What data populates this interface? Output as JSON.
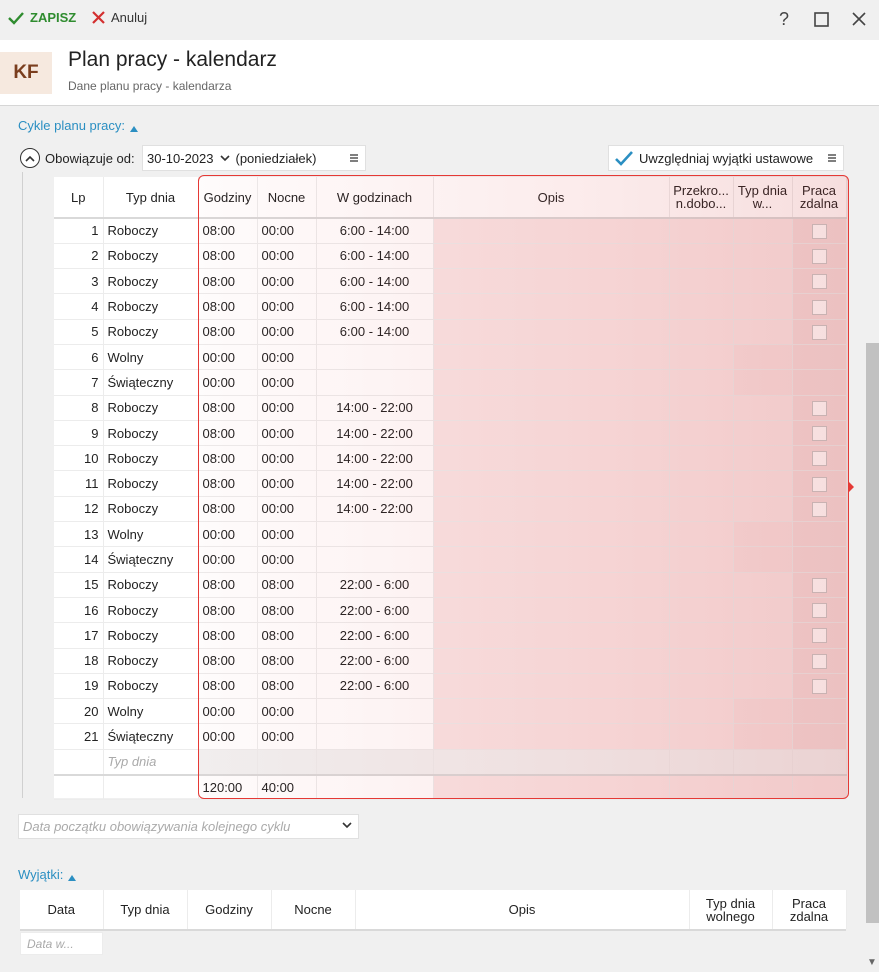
{
  "toolbar": {
    "save_label": "ZAPISZ",
    "cancel_label": "Anuluj"
  },
  "window": {
    "help_glyph": "?",
    "max_glyph": "☐",
    "close_glyph": "✕"
  },
  "header": {
    "avatar": "KF",
    "title": "Plan pracy - kalendarz",
    "subtitle": "Dane planu pracy - kalendarza"
  },
  "cycles": {
    "section_label": "Cykle planu pracy:",
    "valid_from_label": "Obowiązuje od:",
    "valid_from_value": "30-10-2023",
    "valid_from_day": "(poniedziałek)",
    "include_exceptions_label": "Uwzględniaj wyjątki ustawowe",
    "include_exceptions_checked": true
  },
  "grid": {
    "columns": [
      "Lp",
      "Typ dnia",
      "Godziny",
      "Nocne",
      "W godzinach",
      "Opis",
      "Przekro... n.dobo...",
      "Typ dnia w...",
      "Praca zdalna"
    ],
    "rows": [
      {
        "lp": "1",
        "typ": "Roboczy",
        "godziny": "08:00",
        "nocne": "00:00",
        "w_godz": "6:00 - 14:00",
        "cb": true
      },
      {
        "lp": "2",
        "typ": "Roboczy",
        "godziny": "08:00",
        "nocne": "00:00",
        "w_godz": "6:00 - 14:00",
        "cb": true
      },
      {
        "lp": "3",
        "typ": "Roboczy",
        "godziny": "08:00",
        "nocne": "00:00",
        "w_godz": "6:00 - 14:00",
        "cb": true
      },
      {
        "lp": "4",
        "typ": "Roboczy",
        "godziny": "08:00",
        "nocne": "00:00",
        "w_godz": "6:00 - 14:00",
        "cb": true
      },
      {
        "lp": "5",
        "typ": "Roboczy",
        "godziny": "08:00",
        "nocne": "00:00",
        "w_godz": "6:00 - 14:00",
        "cb": true
      },
      {
        "lp": "6",
        "typ": "Wolny",
        "godziny": "00:00",
        "nocne": "00:00",
        "w_godz": "",
        "cb": false
      },
      {
        "lp": "7",
        "typ": "Świąteczny",
        "godziny": "00:00",
        "nocne": "00:00",
        "w_godz": "",
        "cb": false
      },
      {
        "lp": "8",
        "typ": "Roboczy",
        "godziny": "08:00",
        "nocne": "00:00",
        "w_godz": "14:00 - 22:00",
        "cb": true
      },
      {
        "lp": "9",
        "typ": "Roboczy",
        "godziny": "08:00",
        "nocne": "00:00",
        "w_godz": "14:00 - 22:00",
        "cb": true
      },
      {
        "lp": "10",
        "typ": "Roboczy",
        "godziny": "08:00",
        "nocne": "00:00",
        "w_godz": "14:00 - 22:00",
        "cb": true
      },
      {
        "lp": "11",
        "typ": "Roboczy",
        "godziny": "08:00",
        "nocne": "00:00",
        "w_godz": "14:00 - 22:00",
        "cb": true
      },
      {
        "lp": "12",
        "typ": "Roboczy",
        "godziny": "08:00",
        "nocne": "00:00",
        "w_godz": "14:00 - 22:00",
        "cb": true
      },
      {
        "lp": "13",
        "typ": "Wolny",
        "godziny": "00:00",
        "nocne": "00:00",
        "w_godz": "",
        "cb": false
      },
      {
        "lp": "14",
        "typ": "Świąteczny",
        "godziny": "00:00",
        "nocne": "00:00",
        "w_godz": "",
        "cb": false
      },
      {
        "lp": "15",
        "typ": "Roboczy",
        "godziny": "08:00",
        "nocne": "08:00",
        "w_godz": "22:00 - 6:00",
        "cb": true
      },
      {
        "lp": "16",
        "typ": "Roboczy",
        "godziny": "08:00",
        "nocne": "08:00",
        "w_godz": "22:00 - 6:00",
        "cb": true
      },
      {
        "lp": "17",
        "typ": "Roboczy",
        "godziny": "08:00",
        "nocne": "08:00",
        "w_godz": "22:00 - 6:00",
        "cb": true
      },
      {
        "lp": "18",
        "typ": "Roboczy",
        "godziny": "08:00",
        "nocne": "08:00",
        "w_godz": "22:00 - 6:00",
        "cb": true
      },
      {
        "lp": "19",
        "typ": "Roboczy",
        "godziny": "08:00",
        "nocne": "08:00",
        "w_godz": "22:00 - 6:00",
        "cb": true
      },
      {
        "lp": "20",
        "typ": "Wolny",
        "godziny": "00:00",
        "nocne": "00:00",
        "w_godz": "",
        "cb": false
      },
      {
        "lp": "21",
        "typ": "Świąteczny",
        "godziny": "00:00",
        "nocne": "00:00",
        "w_godz": "",
        "cb": false
      }
    ],
    "new_row_placeholder": "Typ dnia",
    "totals": {
      "godziny": "120:00",
      "nocne": "40:00"
    }
  },
  "next_cycle": {
    "placeholder": "Data początku obowiązywania kolejnego cyklu"
  },
  "exceptions": {
    "section_label": "Wyjątki:",
    "columns": [
      "Data",
      "Typ dnia",
      "Godziny",
      "Nocne",
      "Opis",
      "Typ dnia wolnego",
      "Praca zdalna"
    ],
    "date_placeholder": "Data w..."
  },
  "colors": {
    "accent": "#2b8fc2",
    "save": "#2f8c2f",
    "cancel": "#d32f2f",
    "highlight": "#e53935"
  }
}
